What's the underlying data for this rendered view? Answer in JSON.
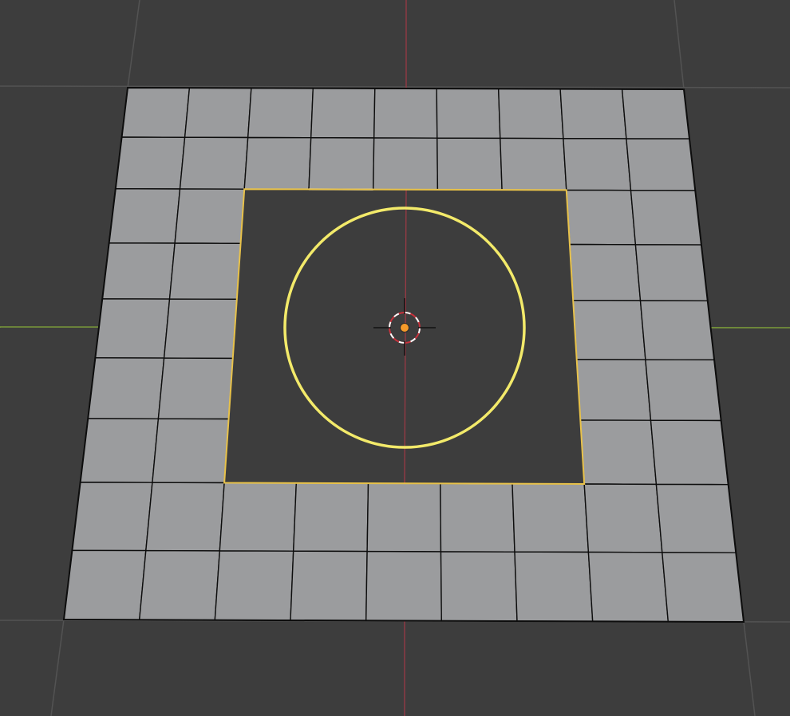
{
  "viewport": {
    "name": "3D Viewport",
    "background_color": "#3d3d3d",
    "grid_line_color": "#535353",
    "x_axis_color": "#7a9a3a",
    "y_axis_color": "#9a3a45"
  },
  "mesh": {
    "type": "grid-plane",
    "rows": 9,
    "cols": 9,
    "face_color": "#9b9c9e",
    "edge_color": "#0d0d0d",
    "hole": {
      "rows": [
        2,
        6
      ],
      "cols": [
        2,
        6
      ],
      "fill_color": "#3d3d3d",
      "outline_color": "#e8c24a"
    },
    "highlighted_edge_color": "#ffffff"
  },
  "circle_object": {
    "state": "selected",
    "color": "#f3ea6a"
  },
  "origin": {
    "color": "#f59a2a"
  },
  "cursor_3d": {
    "ring_color_a": "#ffffff",
    "ring_color_b": "#c8323c",
    "cross_color": "#111111"
  }
}
